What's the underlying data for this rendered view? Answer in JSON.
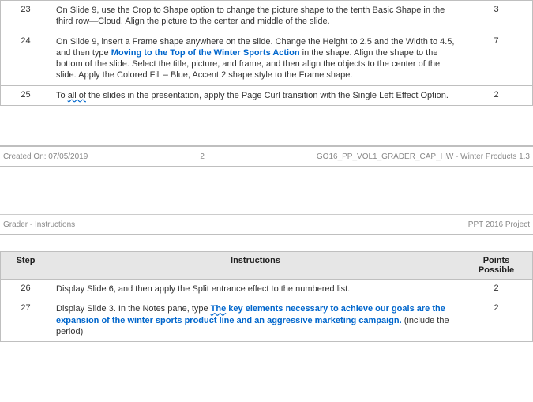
{
  "page1": {
    "rows": [
      {
        "step": "23",
        "instr": "On Slide 9, use the Crop to Shape option to change the picture shape to the tenth Basic Shape in the third row—Cloud. Align the picture to the center and middle of the slide.",
        "points": "3"
      },
      {
        "step": "24",
        "instr_pre": "On Slide 9, insert a Frame shape anywhere on the slide. Change the Height to 2.5 and the Width to 4.5, and then type ",
        "typed_text": "Moving to the Top of the Winter Sports Action",
        "instr_post": " in the shape. Align the shape to the bottom of the slide. Select the title, picture, and frame, and then align the objects to the center of the slide. Apply the Colored Fill – Blue, Accent 2 shape style to the Frame shape.",
        "points": "7"
      },
      {
        "step": "25",
        "instr_pre": "To ",
        "squiggle": "all of",
        "instr_post": " the slides in the presentation, apply the Page Curl transition with the Single Left Effect Option.",
        "points": "2"
      }
    ]
  },
  "footer": {
    "left": "Created On: 07/05/2019",
    "center": "2",
    "right": "GO16_PP_VOL1_GRADER_CAP_HW - Winter Products 1.3"
  },
  "header2": {
    "left": "Grader - Instructions",
    "right": "PPT 2016 Project"
  },
  "table2_headers": {
    "step": "Step",
    "instructions": "Instructions",
    "points": "Points Possible"
  },
  "page2": {
    "rows": [
      {
        "step": "26",
        "instr": "Display Slide 6, and then apply the Split entrance effect to the numbered list.",
        "points": "2"
      },
      {
        "step": "27",
        "instr_pre": "Display Slide 3. In the Notes pane, type ",
        "typed_text_a": "The",
        "typed_text_b": " key elements necessary to achieve our goals are the expansion of the winter sports product line and an aggressive marketing campaign.",
        "instr_post": " (include the period)",
        "points": "2"
      }
    ]
  }
}
